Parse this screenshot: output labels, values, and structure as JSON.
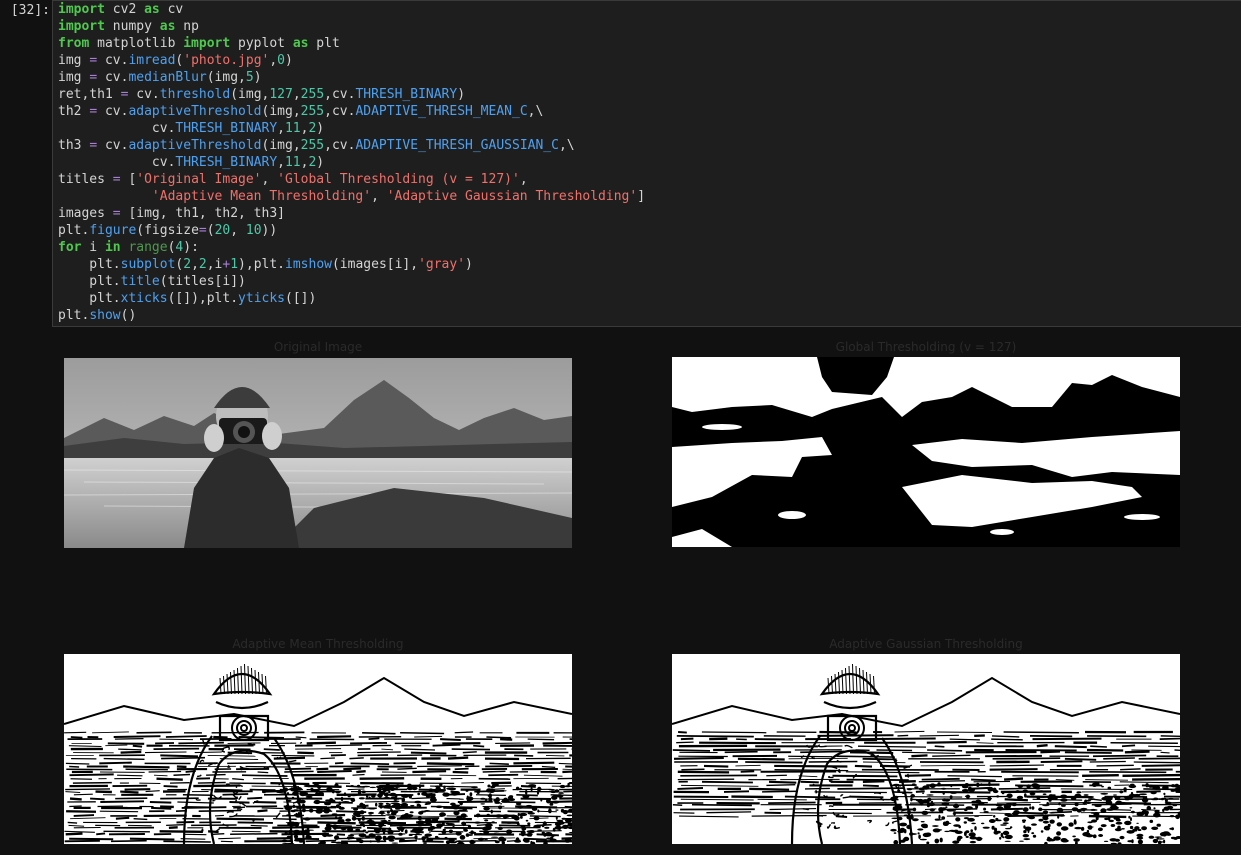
{
  "cell": {
    "prompt": "[32]:",
    "lines": [
      [
        [
          "k",
          "import"
        ],
        [
          "t",
          " cv2 "
        ],
        [
          "k",
          "as"
        ],
        [
          "t",
          " cv"
        ]
      ],
      [
        [
          "k",
          "import"
        ],
        [
          "t",
          " numpy "
        ],
        [
          "k",
          "as"
        ],
        [
          "t",
          " np"
        ]
      ],
      [
        [
          "k",
          "from"
        ],
        [
          "t",
          " matplotlib "
        ],
        [
          "k",
          "import"
        ],
        [
          "t",
          " pyplot "
        ],
        [
          "k",
          "as"
        ],
        [
          "t",
          " plt"
        ]
      ],
      [
        [
          "t",
          "img "
        ],
        [
          "o",
          "="
        ],
        [
          "t",
          " cv."
        ],
        [
          "f",
          "imread"
        ],
        [
          "t",
          "("
        ],
        [
          "s",
          "'photo.jpg'"
        ],
        [
          "t",
          ","
        ],
        [
          "n",
          "0"
        ],
        [
          "t",
          ")"
        ]
      ],
      [
        [
          "t",
          "img "
        ],
        [
          "o",
          "="
        ],
        [
          "t",
          " cv."
        ],
        [
          "f",
          "medianBlur"
        ],
        [
          "t",
          "(img,"
        ],
        [
          "n",
          "5"
        ],
        [
          "t",
          ")"
        ]
      ],
      [
        [
          "t",
          "ret,th1 "
        ],
        [
          "o",
          "="
        ],
        [
          "t",
          " cv."
        ],
        [
          "f",
          "threshold"
        ],
        [
          "t",
          "(img,"
        ],
        [
          "n",
          "127"
        ],
        [
          "t",
          ","
        ],
        [
          "n",
          "255"
        ],
        [
          "t",
          ",cv."
        ],
        [
          "f",
          "THRESH_BINARY"
        ],
        [
          "t",
          ")"
        ]
      ],
      [
        [
          "t",
          "th2 "
        ],
        [
          "o",
          "="
        ],
        [
          "t",
          " cv."
        ],
        [
          "f",
          "adaptiveThreshold"
        ],
        [
          "t",
          "(img,"
        ],
        [
          "n",
          "255"
        ],
        [
          "t",
          ",cv."
        ],
        [
          "f",
          "ADAPTIVE_THRESH_MEAN_C"
        ],
        [
          "t",
          ",\\"
        ]
      ],
      [
        [
          "t",
          "            cv."
        ],
        [
          "f",
          "THRESH_BINARY"
        ],
        [
          "t",
          ","
        ],
        [
          "n",
          "11"
        ],
        [
          "t",
          ","
        ],
        [
          "n",
          "2"
        ],
        [
          "t",
          ")"
        ]
      ],
      [
        [
          "t",
          "th3 "
        ],
        [
          "o",
          "="
        ],
        [
          "t",
          " cv."
        ],
        [
          "f",
          "adaptiveThreshold"
        ],
        [
          "t",
          "(img,"
        ],
        [
          "n",
          "255"
        ],
        [
          "t",
          ",cv."
        ],
        [
          "f",
          "ADAPTIVE_THRESH_GAUSSIAN_C"
        ],
        [
          "t",
          ",\\"
        ]
      ],
      [
        [
          "t",
          "            cv."
        ],
        [
          "f",
          "THRESH_BINARY"
        ],
        [
          "t",
          ","
        ],
        [
          "n",
          "11"
        ],
        [
          "t",
          ","
        ],
        [
          "n",
          "2"
        ],
        [
          "t",
          ")"
        ]
      ],
      [
        [
          "t",
          "titles "
        ],
        [
          "o",
          "="
        ],
        [
          "t",
          " ["
        ],
        [
          "s",
          "'Original Image'"
        ],
        [
          "t",
          ", "
        ],
        [
          "s",
          "'Global Thresholding (v = 127)'"
        ],
        [
          "t",
          ","
        ]
      ],
      [
        [
          "t",
          "            "
        ],
        [
          "s",
          "'Adaptive Mean Thresholding'"
        ],
        [
          "t",
          ", "
        ],
        [
          "s",
          "'Adaptive Gaussian Thresholding'"
        ],
        [
          "t",
          "]"
        ]
      ],
      [
        [
          "t",
          "images "
        ],
        [
          "o",
          "="
        ],
        [
          "t",
          " [img, th1, th2, th3]"
        ]
      ],
      [
        [
          "t",
          "plt."
        ],
        [
          "f",
          "figure"
        ],
        [
          "t",
          "(figsize"
        ],
        [
          "o",
          "="
        ],
        [
          "t",
          "("
        ],
        [
          "n",
          "20"
        ],
        [
          "t",
          ", "
        ],
        [
          "n",
          "10"
        ],
        [
          "t",
          "))"
        ]
      ],
      [
        [
          "k",
          "for"
        ],
        [
          "t",
          " i "
        ],
        [
          "k",
          "in"
        ],
        [
          "t",
          " "
        ],
        [
          "b",
          "range"
        ],
        [
          "t",
          "("
        ],
        [
          "n",
          "4"
        ],
        [
          "t",
          "):"
        ]
      ],
      [
        [
          "t",
          "    plt."
        ],
        [
          "f",
          "subplot"
        ],
        [
          "t",
          "("
        ],
        [
          "n",
          "2"
        ],
        [
          "t",
          ","
        ],
        [
          "n",
          "2"
        ],
        [
          "t",
          ",i"
        ],
        [
          "o",
          "+"
        ],
        [
          "n",
          "1"
        ],
        [
          "t",
          "),plt."
        ],
        [
          "f",
          "imshow"
        ],
        [
          "t",
          "(images[i],"
        ],
        [
          "s",
          "'gray'"
        ],
        [
          "t",
          ")"
        ]
      ],
      [
        [
          "t",
          "    plt."
        ],
        [
          "f",
          "title"
        ],
        [
          "t",
          "(titles[i])"
        ]
      ],
      [
        [
          "t",
          "    plt."
        ],
        [
          "f",
          "xticks"
        ],
        [
          "t",
          "([]),plt."
        ],
        [
          "f",
          "yticks"
        ],
        [
          "t",
          "([])"
        ]
      ],
      [
        [
          "t",
          "plt."
        ],
        [
          "f",
          "show"
        ],
        [
          "t",
          "()"
        ]
      ]
    ]
  },
  "output": {
    "panels": [
      {
        "title": "Original Image",
        "kind": "gray",
        "image_icon": "photo-original-icon"
      },
      {
        "title": "Global Thresholding (v = 127)",
        "kind": "global",
        "image_icon": "photo-global-threshold-icon"
      },
      {
        "title": "Adaptive Mean Thresholding",
        "kind": "mean",
        "image_icon": "photo-adaptive-mean-icon"
      },
      {
        "title": "Adaptive Gaussian Thresholding",
        "kind": "gauss",
        "image_icon": "photo-adaptive-gaussian-icon"
      }
    ]
  },
  "colors": {
    "background": "#111111",
    "cell_background": "#1e1e1e",
    "keyword": "#4ec94e",
    "function": "#4ea1f0",
    "string": "#f0706a",
    "number": "#4ec9a8",
    "operator": "#a97fd6"
  }
}
